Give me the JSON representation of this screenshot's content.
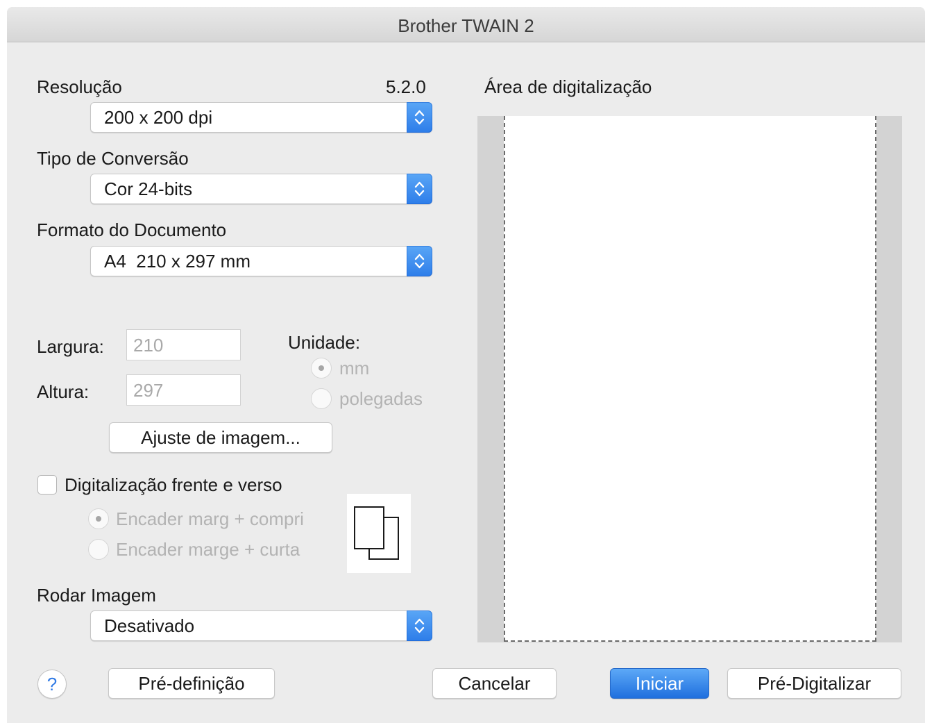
{
  "window": {
    "title": "Brother TWAIN 2"
  },
  "version": "5.2.0",
  "resolution": {
    "label": "Resolução",
    "value": "200 x 200 dpi"
  },
  "conversion": {
    "label": "Tipo de Conversão",
    "value": "Cor 24-bits"
  },
  "doc_format": {
    "label": "Formato do Documento",
    "value": "A4  210 x 297 mm"
  },
  "dimensions": {
    "width_label": "Largura:",
    "width_value": "210",
    "height_label": "Altura:",
    "height_value": "297"
  },
  "unit": {
    "label": "Unidade:",
    "options": [
      "mm",
      "polegadas"
    ],
    "selected": "mm"
  },
  "image_adjust_button": "Ajuste de imagem...",
  "duplex": {
    "label": "Digitalização frente e verso",
    "checked": false,
    "options": [
      "Encader marg + compri",
      "Encader marge + curta"
    ],
    "selected": "Encader marg + compri"
  },
  "rotate": {
    "label": "Rodar Imagem",
    "value": "Desativado"
  },
  "scan_area": {
    "label": "Área de digitalização"
  },
  "buttons": {
    "help": "?",
    "preset": "Pré-definição",
    "cancel": "Cancelar",
    "start": "Iniciar",
    "prescan": "Pré-Digitalizar"
  },
  "colors": {
    "accent": "#2d7de9",
    "window_bg": "#ececec",
    "disabled_text": "#b3b3b3"
  }
}
